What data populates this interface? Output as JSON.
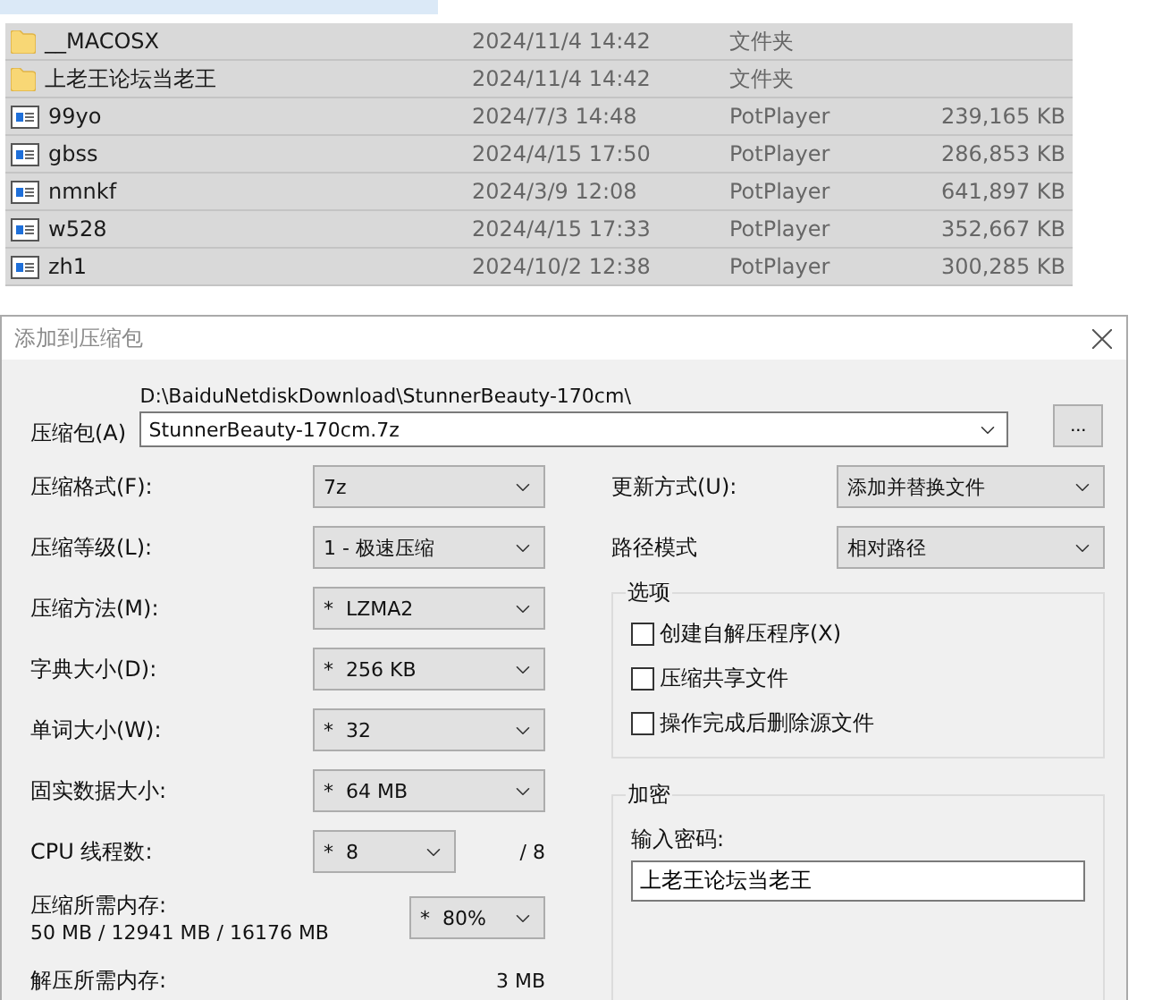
{
  "files": [
    {
      "kind": "folder",
      "name": "__MACOSX",
      "date": "2024/11/4 14:42",
      "type": "文件夹"
    },
    {
      "kind": "folder",
      "name": "上老王论坛当老王",
      "date": "2024/11/4 14:42",
      "type": "文件夹"
    },
    {
      "kind": "video",
      "name": "99yo",
      "date": "2024/7/3 14:48",
      "type": "PotPlayer",
      "size": "239,165 KB"
    },
    {
      "kind": "video",
      "name": "gbss",
      "date": "2024/4/15 17:50",
      "type": "PotPlayer",
      "size": "286,853 KB"
    },
    {
      "kind": "video",
      "name": "nmnkf",
      "date": "2024/3/9 12:08",
      "type": "PotPlayer",
      "size": "641,897 KB"
    },
    {
      "kind": "video",
      "name": "w528",
      "date": "2024/4/15 17:33",
      "type": "PotPlayer",
      "size": "352,667 KB"
    },
    {
      "kind": "video",
      "name": "zh1",
      "date": "2024/10/2 12:38",
      "type": "PotPlayer",
      "size": "300,285 KB"
    }
  ],
  "dialog": {
    "title": "添加到压缩包",
    "archive": {
      "label": "压缩包(A)",
      "path": "D:\\BaiduNetdiskDownload\\StunnerBeauty-170cm\\",
      "value": "StunnerBeauty-170cm.7z",
      "browse": "..."
    },
    "left_fields": [
      {
        "kind": "select",
        "label": "压缩格式(F):",
        "value": "7z"
      },
      {
        "kind": "select",
        "label": "压缩等级(L):",
        "value": "1 - 极速压缩"
      },
      {
        "kind": "select",
        "label": "压缩方法(M):",
        "value": "*  LZMA2"
      },
      {
        "kind": "select",
        "label": "字典大小(D):",
        "value": "*  256 KB"
      },
      {
        "kind": "select",
        "label": "单词大小(W):",
        "value": "*  32"
      },
      {
        "kind": "select",
        "label": "固实数据大小:",
        "value": "*  64 MB"
      },
      {
        "kind": "threads",
        "label": "CPU 线程数:",
        "value": "*  8",
        "total": "/ 8"
      },
      {
        "kind": "memory",
        "label": "压缩所需内存:",
        "detail": "50 MB / 12941 MB / 16176 MB",
        "value": "*  80%"
      },
      {
        "kind": "reading",
        "label": "解压所需内存:",
        "value": "3 MB"
      }
    ],
    "right_fields": [
      {
        "label": "更新方式(U):",
        "value": "添加并替换文件"
      },
      {
        "label": "路径模式",
        "value": "相对路径"
      }
    ],
    "options": {
      "title": "选项",
      "items": [
        {
          "label": "创建自解压程序(X)",
          "checked": false
        },
        {
          "label": "压缩共享文件",
          "checked": false
        },
        {
          "label": "操作完成后删除源文件",
          "checked": false
        }
      ]
    },
    "encryption": {
      "title": "加密",
      "label": "输入密码:",
      "value": "上老王论坛当老王"
    }
  }
}
